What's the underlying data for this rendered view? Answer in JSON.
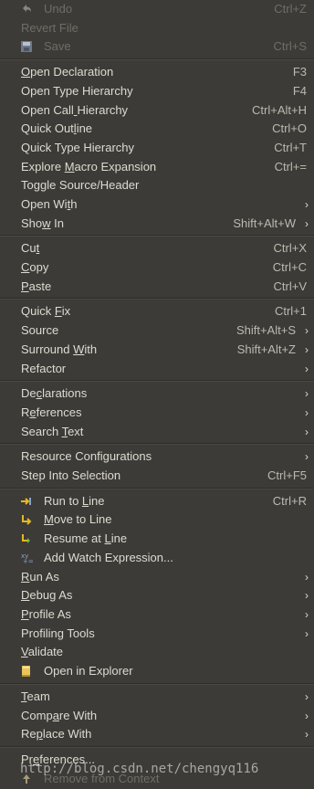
{
  "menu": {
    "items": [
      {
        "label": "Undo",
        "ul": -1,
        "shortcut": "Ctrl+Z",
        "icon": "undo-icon",
        "disabled": true,
        "submenu": false
      },
      {
        "label": "Revert File",
        "ul": -1,
        "shortcut": "",
        "icon": "",
        "disabled": true,
        "submenu": false
      },
      {
        "label": "Save",
        "ul": -1,
        "shortcut": "Ctrl+S",
        "icon": "save-icon",
        "disabled": true,
        "submenu": false,
        "sep_after": true
      },
      {
        "label": "Open Declaration",
        "ul": 0,
        "shortcut": "F3",
        "icon": "",
        "disabled": false,
        "submenu": false
      },
      {
        "label": "Open Type Hierarchy",
        "ul": -1,
        "shortcut": "F4",
        "icon": "",
        "disabled": false,
        "submenu": false
      },
      {
        "label": "Open Call Hierarchy",
        "ul": 9,
        "shortcut": "Ctrl+Alt+H",
        "icon": "",
        "disabled": false,
        "submenu": false
      },
      {
        "label": "Quick Outline",
        "ul": 9,
        "shortcut": "Ctrl+O",
        "icon": "",
        "disabled": false,
        "submenu": false
      },
      {
        "label": "Quick Type Hierarchy",
        "ul": -1,
        "shortcut": "Ctrl+T",
        "icon": "",
        "disabled": false,
        "submenu": false
      },
      {
        "label": "Explore Macro Expansion",
        "ul": 8,
        "shortcut": "Ctrl+=",
        "icon": "",
        "disabled": false,
        "submenu": false
      },
      {
        "label": "Toggle Source/Header",
        "ul": -1,
        "shortcut": "",
        "icon": "",
        "disabled": false,
        "submenu": false
      },
      {
        "label": "Open With",
        "ul": 7,
        "shortcut": "",
        "icon": "",
        "disabled": false,
        "submenu": true
      },
      {
        "label": "Show In",
        "ul": 3,
        "shortcut": "Shift+Alt+W",
        "icon": "",
        "disabled": false,
        "submenu": true,
        "sep_after": true
      },
      {
        "label": "Cut",
        "ul": 2,
        "shortcut": "Ctrl+X",
        "icon": "",
        "disabled": false,
        "submenu": false
      },
      {
        "label": "Copy",
        "ul": 0,
        "shortcut": "Ctrl+C",
        "icon": "",
        "disabled": false,
        "submenu": false
      },
      {
        "label": "Paste",
        "ul": 0,
        "shortcut": "Ctrl+V",
        "icon": "",
        "disabled": false,
        "submenu": false,
        "sep_after": true
      },
      {
        "label": "Quick Fix",
        "ul": 6,
        "shortcut": "Ctrl+1",
        "icon": "",
        "disabled": false,
        "submenu": false
      },
      {
        "label": "Source",
        "ul": -1,
        "shortcut": "Shift+Alt+S",
        "icon": "",
        "disabled": false,
        "submenu": true
      },
      {
        "label": "Surround With",
        "ul": 9,
        "shortcut": "Shift+Alt+Z",
        "icon": "",
        "disabled": false,
        "submenu": true
      },
      {
        "label": "Refactor",
        "ul": -1,
        "shortcut": "",
        "icon": "",
        "disabled": false,
        "submenu": true,
        "sep_after": true
      },
      {
        "label": "Declarations",
        "ul": 2,
        "shortcut": "",
        "icon": "",
        "disabled": false,
        "submenu": true
      },
      {
        "label": "References",
        "ul": 1,
        "shortcut": "",
        "icon": "",
        "disabled": false,
        "submenu": true
      },
      {
        "label": "Search Text",
        "ul": 7,
        "shortcut": "",
        "icon": "",
        "disabled": false,
        "submenu": true,
        "sep_after": true
      },
      {
        "label": "Resource Configurations",
        "ul": -1,
        "shortcut": "",
        "icon": "",
        "disabled": false,
        "submenu": true
      },
      {
        "label": "Step Into Selection",
        "ul": -1,
        "shortcut": "Ctrl+F5",
        "icon": "",
        "disabled": false,
        "submenu": false,
        "sep_after": true
      },
      {
        "label": "Run to Line",
        "ul": 7,
        "shortcut": "Ctrl+R",
        "icon": "run-to-line-icon",
        "disabled": false,
        "submenu": false
      },
      {
        "label": "Move to Line",
        "ul": 0,
        "shortcut": "",
        "icon": "move-to-line-icon",
        "disabled": false,
        "submenu": false
      },
      {
        "label": "Resume at Line",
        "ul": 10,
        "shortcut": "",
        "icon": "resume-at-line-icon",
        "disabled": false,
        "submenu": false
      },
      {
        "label": "Add Watch Expression...",
        "ul": -1,
        "shortcut": "",
        "icon": "watch-expression-icon",
        "disabled": false,
        "submenu": false
      },
      {
        "label": "Run As",
        "ul": 0,
        "shortcut": "",
        "icon": "",
        "disabled": false,
        "submenu": true
      },
      {
        "label": "Debug As",
        "ul": 0,
        "shortcut": "",
        "icon": "",
        "disabled": false,
        "submenu": true
      },
      {
        "label": "Profile As",
        "ul": 0,
        "shortcut": "",
        "icon": "",
        "disabled": false,
        "submenu": true
      },
      {
        "label": "Profiling Tools",
        "ul": -1,
        "shortcut": "",
        "icon": "",
        "disabled": false,
        "submenu": true
      },
      {
        "label": "Validate",
        "ul": 0,
        "shortcut": "",
        "icon": "",
        "disabled": false,
        "submenu": false
      },
      {
        "label": "Open in Explorer",
        "ul": -1,
        "shortcut": "",
        "icon": "folder-icon",
        "disabled": false,
        "submenu": false,
        "sep_after": true
      },
      {
        "label": "Team",
        "ul": 0,
        "shortcut": "",
        "icon": "",
        "disabled": false,
        "submenu": true
      },
      {
        "label": "Compare With",
        "ul": 4,
        "shortcut": "",
        "icon": "",
        "disabled": false,
        "submenu": true
      },
      {
        "label": "Replace With",
        "ul": 2,
        "shortcut": "",
        "icon": "",
        "disabled": false,
        "submenu": true,
        "sep_after": true
      },
      {
        "label": "Preferences...",
        "ul": 2,
        "shortcut": "",
        "icon": "",
        "disabled": false,
        "submenu": false
      },
      {
        "label": "Remove from Context",
        "ul": -1,
        "shortcut": "",
        "icon": "remove-context-icon",
        "disabled": true,
        "submenu": false
      }
    ]
  },
  "submenu_arrow": "›",
  "watermark": "http://blog.csdn.net/chengyq116",
  "colors": {
    "background": "#3c3b37",
    "text": "#dfdbd2",
    "disabled": "#6f6d66",
    "icon_yellow": "#e8b81e"
  }
}
